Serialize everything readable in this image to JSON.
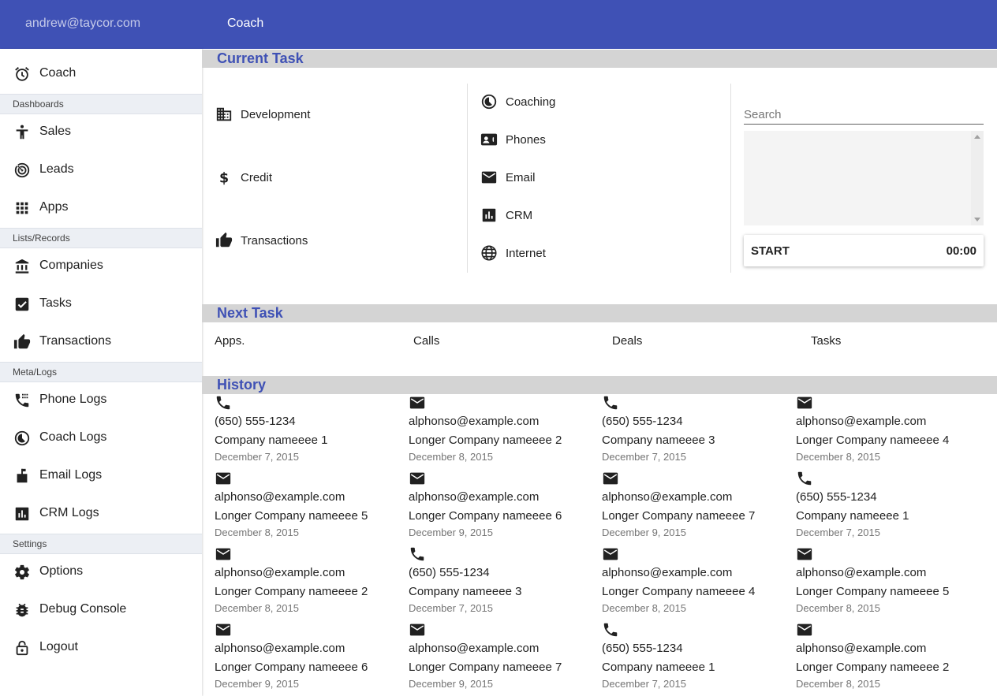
{
  "topbar": {
    "user": "andrew@taycor.com",
    "title": "Coach"
  },
  "colors": {
    "primary": "#3f51b5",
    "section_header_bg": "#d4d4d4",
    "nav_section_bg": "#eceff4"
  },
  "sidebar": {
    "items": [
      {
        "label": "Coach",
        "icon": "alarm-icon"
      },
      {
        "label": "Sales",
        "icon": "accessibility-icon"
      },
      {
        "label": "Leads",
        "icon": "radar-icon"
      },
      {
        "label": "Apps",
        "icon": "apps-grid-icon"
      },
      {
        "label": "Companies",
        "icon": "bank-icon"
      },
      {
        "label": "Tasks",
        "icon": "check-box-icon"
      },
      {
        "label": "Transactions",
        "icon": "thumb-up-icon"
      },
      {
        "label": "Phone Logs",
        "icon": "phone-log-icon"
      },
      {
        "label": "Coach Logs",
        "icon": "timelapse-icon"
      },
      {
        "label": "Email Logs",
        "icon": "mailbox-icon"
      },
      {
        "label": "CRM Logs",
        "icon": "chart-icon"
      },
      {
        "label": "Options",
        "icon": "gear-icon"
      },
      {
        "label": "Debug Console",
        "icon": "bug-icon"
      },
      {
        "label": "Logout",
        "icon": "lock-icon"
      }
    ],
    "sections": [
      "Dashboards",
      "Lists/Records",
      "Meta/Logs",
      "Settings"
    ]
  },
  "current_task": {
    "heading": "Current Task",
    "col1": [
      {
        "label": "Development",
        "icon": "building-icon"
      },
      {
        "label": "Credit",
        "icon": "dollar-icon"
      },
      {
        "label": "Transactions",
        "icon": "thumb-up-icon"
      }
    ],
    "col2": [
      {
        "label": "Coaching",
        "icon": "timelapse-icon"
      },
      {
        "label": "Phones",
        "icon": "contact-card-icon"
      },
      {
        "label": "Email",
        "icon": "envelope-icon"
      },
      {
        "label": "CRM",
        "icon": "chart-icon"
      },
      {
        "label": "Internet",
        "icon": "globe-icon"
      }
    ],
    "search": {
      "placeholder": "Search"
    },
    "timer": {
      "start_label": "START",
      "time": "00:00"
    }
  },
  "next_task": {
    "heading": "Next Task",
    "items": [
      "Apps.",
      "Calls",
      "Deals",
      "Tasks"
    ]
  },
  "history": {
    "heading": "History",
    "entries": [
      {
        "type": "phone",
        "contact": "(650) 555-1234",
        "company": "Company nameeee 1",
        "date": "December 7, 2015"
      },
      {
        "type": "email",
        "contact": "alphonso@example.com",
        "company": "Longer Company nameeee 2",
        "date": "December 8, 2015"
      },
      {
        "type": "phone",
        "contact": "(650) 555-1234",
        "company": "Company nameeee 3",
        "date": "December 7, 2015"
      },
      {
        "type": "email",
        "contact": "alphonso@example.com",
        "company": "Longer Company nameeee 4",
        "date": "December 8, 2015"
      },
      {
        "type": "email",
        "contact": "alphonso@example.com",
        "company": "Longer Company nameeee 5",
        "date": "December 8, 2015"
      },
      {
        "type": "email",
        "contact": "alphonso@example.com",
        "company": "Longer Company nameeee 6",
        "date": "December 9, 2015"
      },
      {
        "type": "email",
        "contact": "alphonso@example.com",
        "company": "Longer Company nameeee 7",
        "date": "December 9, 2015"
      },
      {
        "type": "phone",
        "contact": "(650) 555-1234",
        "company": "Company nameeee 1",
        "date": "December 7, 2015"
      },
      {
        "type": "email",
        "contact": "alphonso@example.com",
        "company": "Longer Company nameeee 2",
        "date": "December 8, 2015"
      },
      {
        "type": "phone",
        "contact": "(650) 555-1234",
        "company": "Company nameeee 3",
        "date": "December 7, 2015"
      },
      {
        "type": "email",
        "contact": "alphonso@example.com",
        "company": "Longer Company nameeee 4",
        "date": "December 8, 2015"
      },
      {
        "type": "email",
        "contact": "alphonso@example.com",
        "company": "Longer Company nameeee 5",
        "date": "December 8, 2015"
      },
      {
        "type": "email",
        "contact": "alphonso@example.com",
        "company": "Longer Company nameeee 6",
        "date": "December 9, 2015"
      },
      {
        "type": "email",
        "contact": "alphonso@example.com",
        "company": "Longer Company nameeee 7",
        "date": "December 9, 2015"
      },
      {
        "type": "phone",
        "contact": "(650) 555-1234",
        "company": "Company nameeee 1",
        "date": "December 7, 2015"
      },
      {
        "type": "email",
        "contact": "alphonso@example.com",
        "company": "Longer Company nameeee 2",
        "date": "December 8, 2015"
      }
    ]
  }
}
